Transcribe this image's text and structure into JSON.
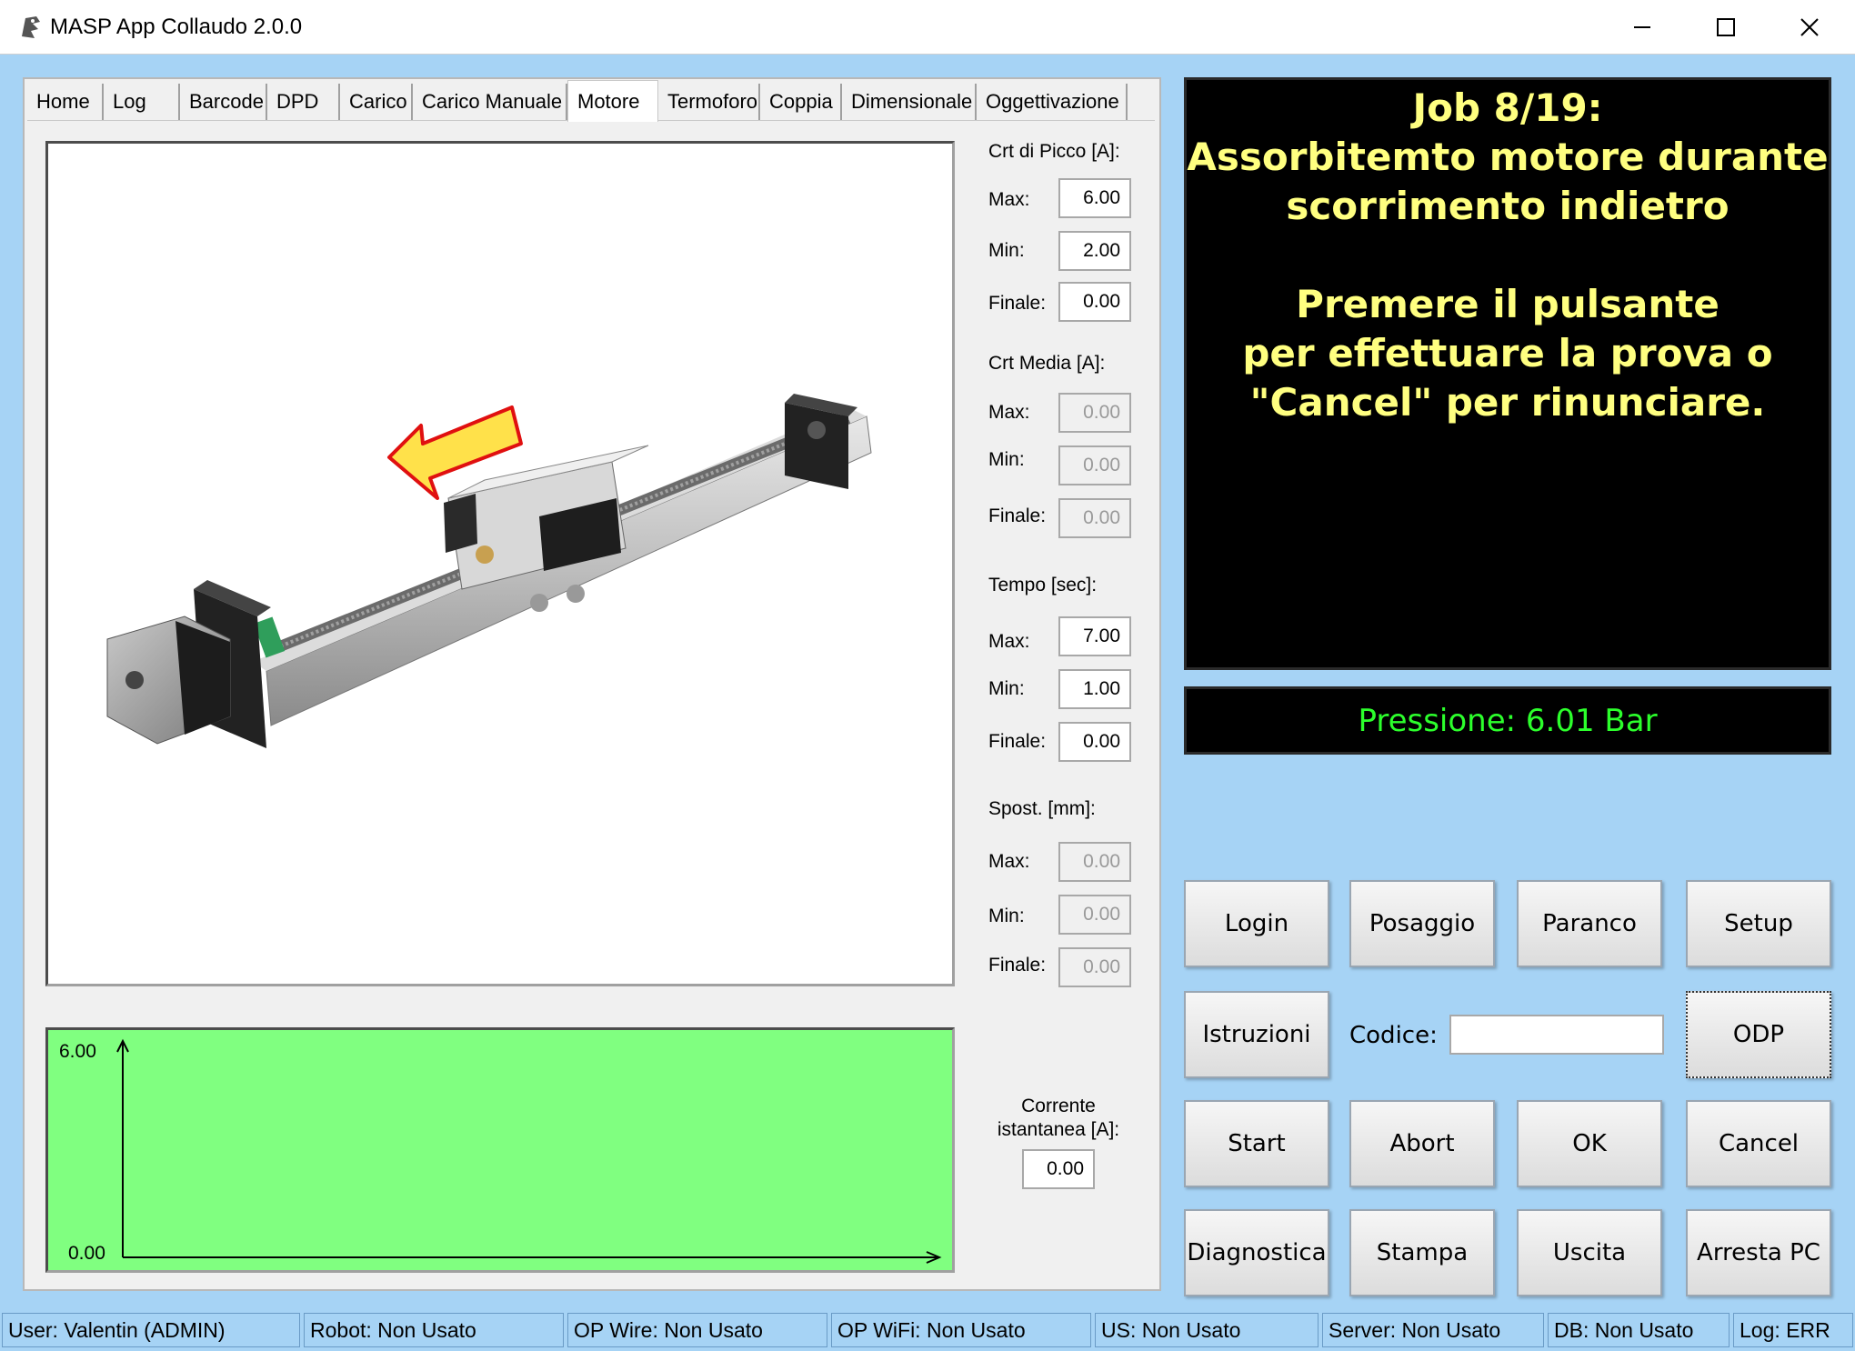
{
  "window": {
    "title": "MASP App Collaudo 2.0.0",
    "minimize_icon": "minimize-icon",
    "maximize_icon": "maximize-icon",
    "close_icon": "close-icon"
  },
  "tabs": [
    "Home",
    "Log",
    "Barcode",
    "DPD",
    "Carico",
    "Carico Manuale",
    "Motore",
    "Termoforo",
    "Coppia",
    "Dimensionale",
    "Oggettivazione"
  ],
  "active_tab": "Motore",
  "sections": {
    "crt_picco": {
      "title": "Crt di Picco [A]:",
      "max_label": "Max:",
      "max": "6.00",
      "min_label": "Min:",
      "min": "2.00",
      "fin_label": "Finale:",
      "fin": "0.00"
    },
    "crt_media": {
      "title": "Crt Media [A]:",
      "max_label": "Max:",
      "max": "0.00",
      "min_label": "Min:",
      "min": "0.00",
      "fin_label": "Finale:",
      "fin": "0.00"
    },
    "tempo": {
      "title": "Tempo [sec]:",
      "max_label": "Max:",
      "max": "7.00",
      "min_label": "Min:",
      "min": "1.00",
      "fin_label": "Finale:",
      "fin": "0.00"
    },
    "spost": {
      "title": "Spost. [mm]:",
      "max_label": "Max:",
      "max": "0.00",
      "min_label": "Min:",
      "min": "0.00",
      "fin_label": "Finale:",
      "fin": "0.00"
    }
  },
  "corrente": {
    "label_line1": "Corrente",
    "label_line2": "istantanea [A]:",
    "value": "0.00"
  },
  "graph": {
    "y_max": "6.00",
    "y_min": "0.00"
  },
  "job": {
    "line1": "Job 8/19:",
    "line2": "Assorbitemto motore durante",
    "line3": "scorrimento indietro",
    "line4": "Premere il pulsante",
    "line5": "per effettuare la prova o",
    "line6": "\"Cancel\" per rinunciare."
  },
  "pressure": "Pressione: 6.01 Bar",
  "buttons": {
    "login": "Login",
    "posaggio": "Posaggio",
    "paranco": "Paranco",
    "setup": "Setup",
    "istruzioni": "Istruzioni",
    "codice_label": "Codice:",
    "codice_value": "",
    "odp": "ODP",
    "start": "Start",
    "abort": "Abort",
    "ok": "OK",
    "cancel": "Cancel",
    "diagnostica": "Diagnostica",
    "stampa": "Stampa",
    "uscita": "Uscita",
    "arresta": "Arresta PC"
  },
  "status": [
    "User: Valentin (ADMIN)",
    "Robot: Non Usato",
    "OP Wire: Non Usato",
    "OP WiFi: Non Usato",
    "US: Non Usato",
    "Server: Non Usato",
    "DB: Non Usato",
    "Log: ERR"
  ],
  "colors": {
    "job_text": "#ffff80",
    "pressure_text": "#2cff2c",
    "graph_bg": "#80ff80",
    "window_bg": "#a6d3f5"
  }
}
